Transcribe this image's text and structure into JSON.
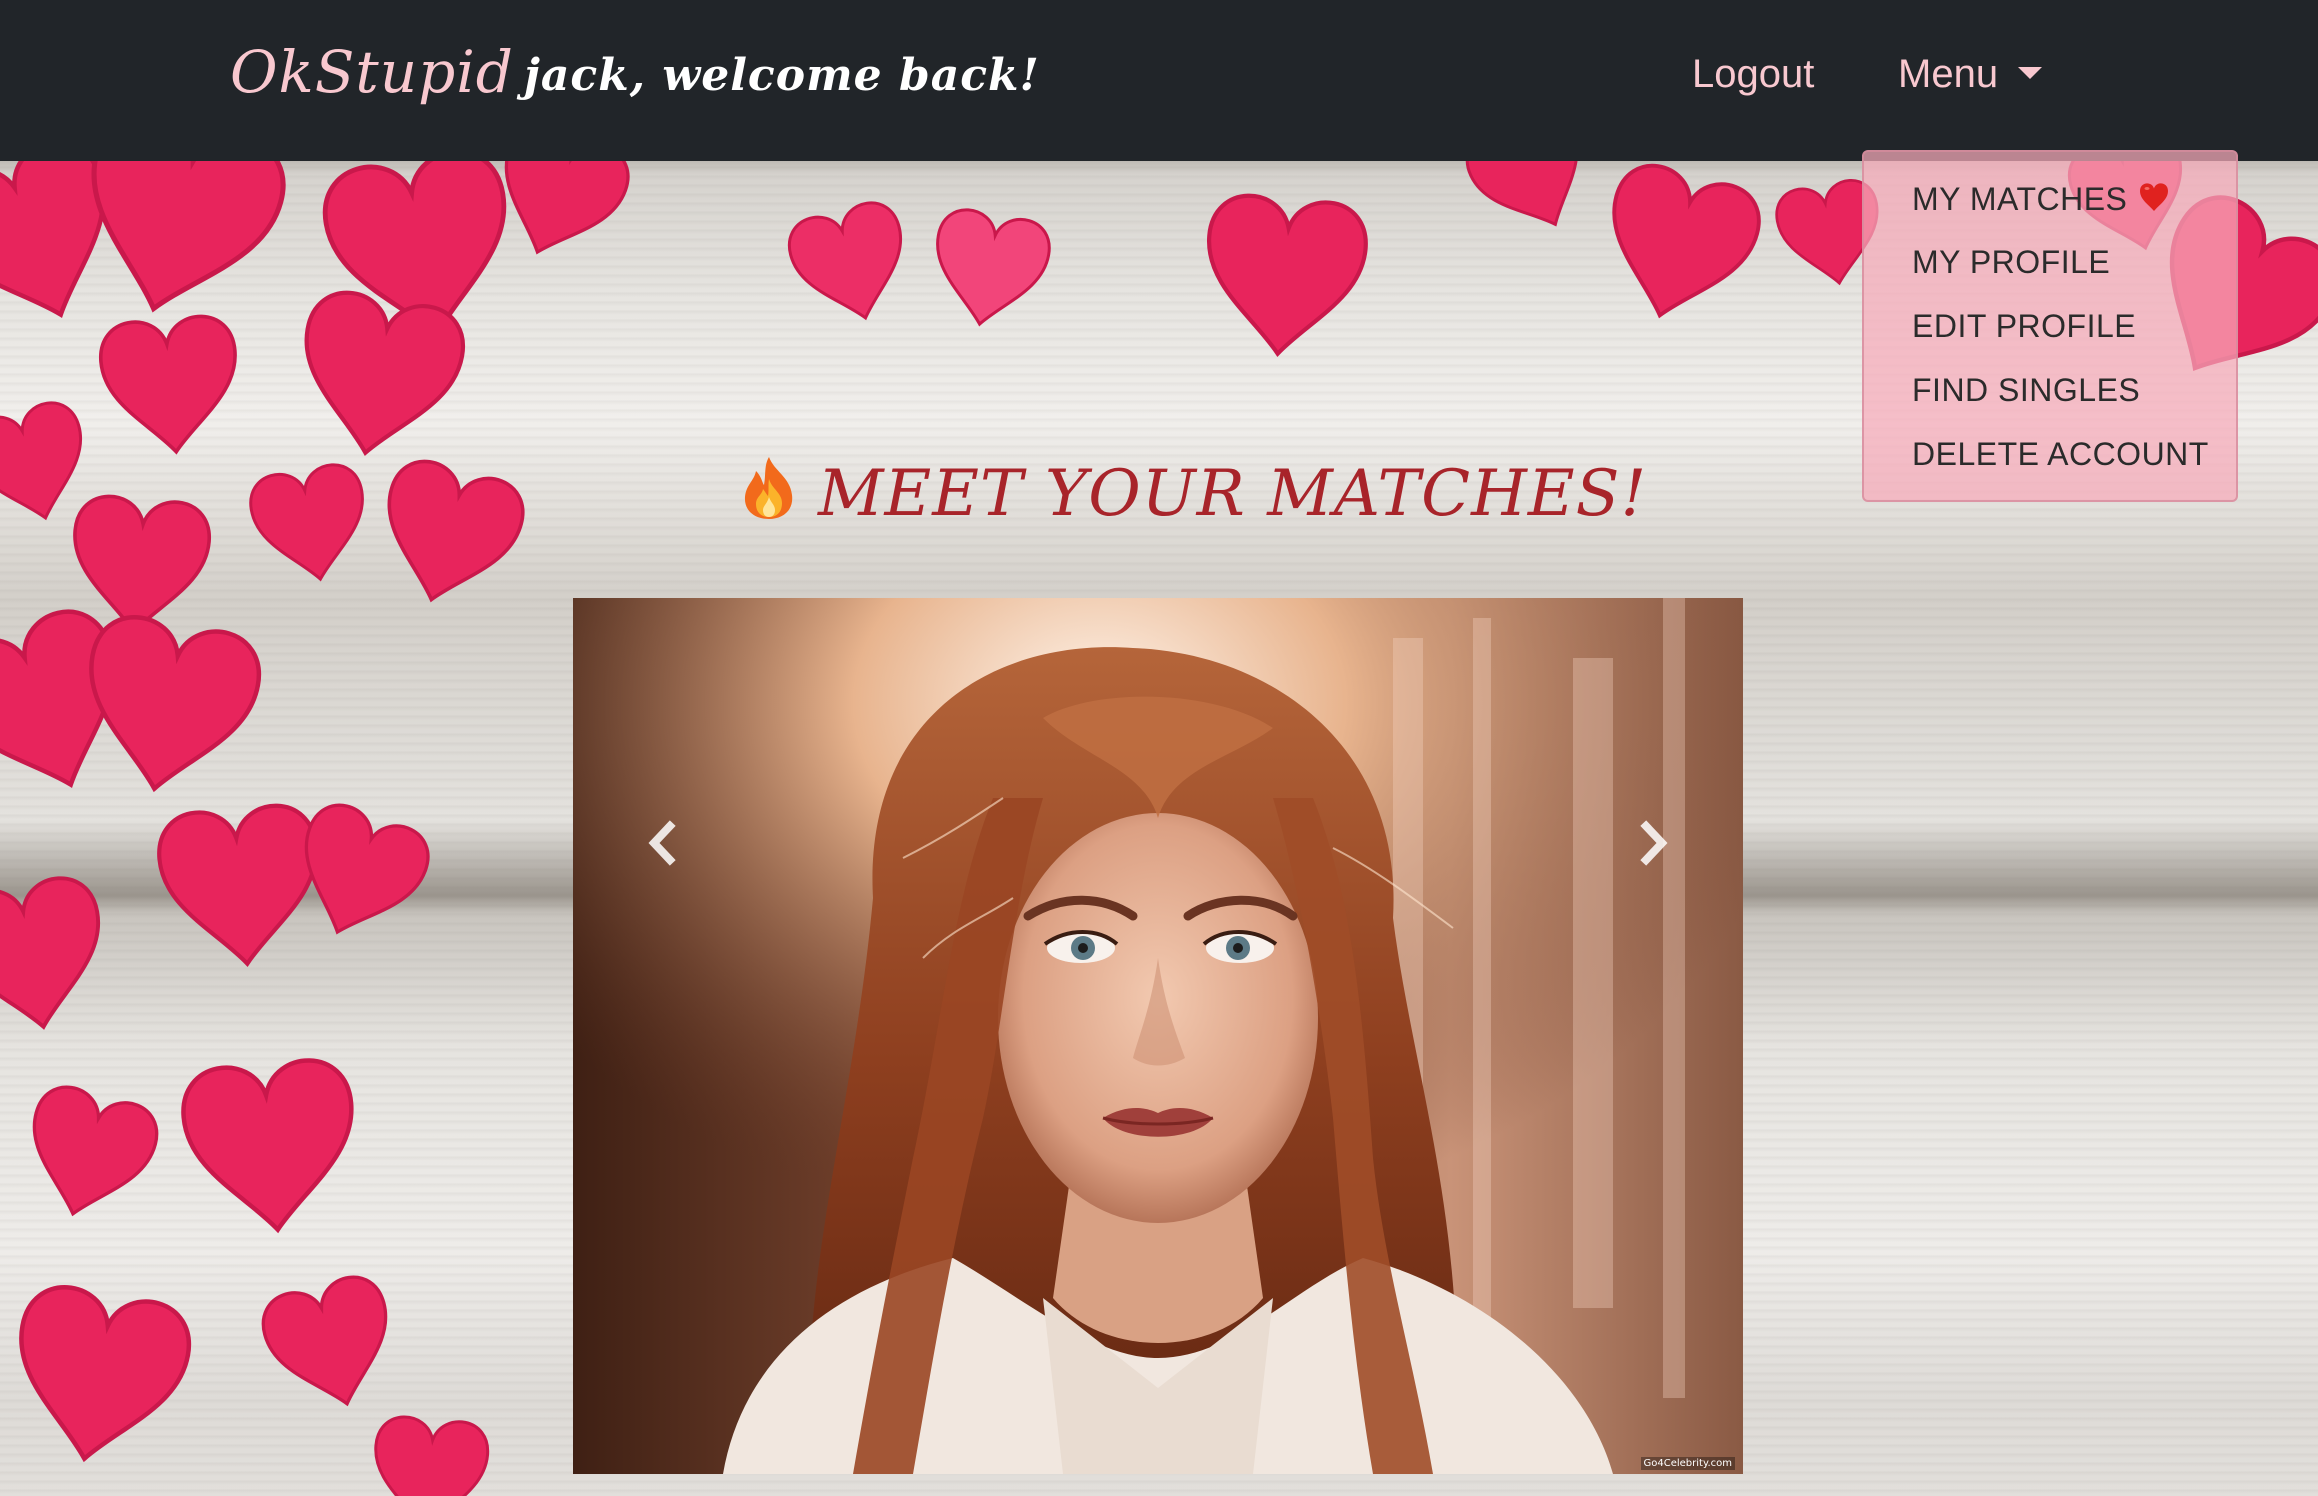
{
  "navbar": {
    "brand": "OkStupid",
    "welcome": "jack, welcome back!",
    "logout_label": "Logout",
    "menu_label": "Menu"
  },
  "menu": {
    "items": [
      {
        "label": "MY MATCHES",
        "icon": "red-heart-icon"
      },
      {
        "label": "MY PROFILE"
      },
      {
        "label": "EDIT PROFILE"
      },
      {
        "label": "FIND SINGLES"
      },
      {
        "label": "DELETE ACCOUNT"
      }
    ]
  },
  "main": {
    "heading": "MEET YOUR MATCHES!",
    "heading_icon": "fire-icon"
  },
  "carousel": {
    "prev_icon": "chevron-left-icon",
    "next_icon": "chevron-right-icon",
    "watermark": "Go4Celebrity.com"
  },
  "colors": {
    "navbar_bg": "#212529",
    "nav_link": "#f8c8cf",
    "heading": "#a8242a",
    "dropdown_bg": "#f6aaba",
    "heart": "#e8245c"
  }
}
